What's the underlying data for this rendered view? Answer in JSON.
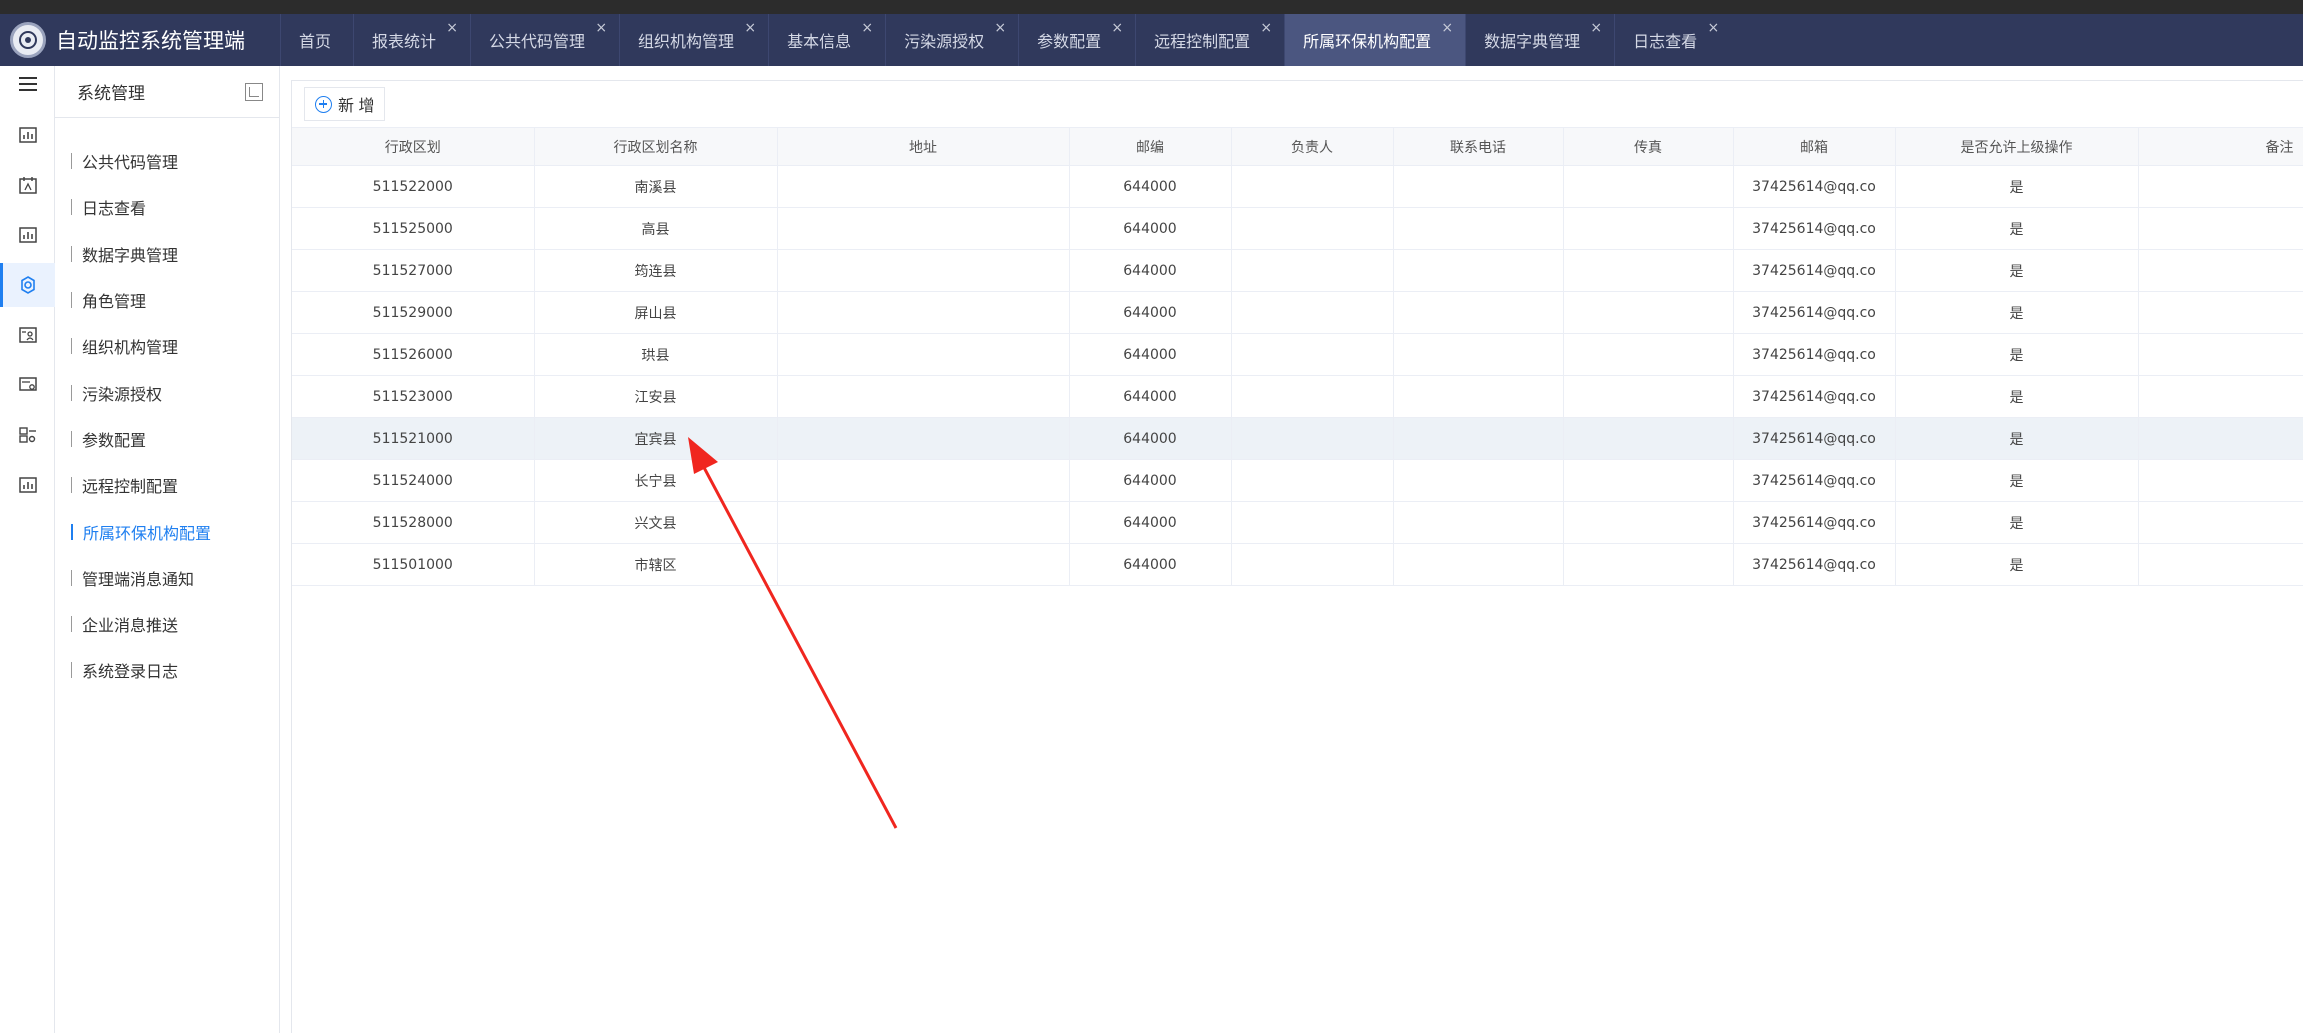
{
  "app": {
    "title": "自动监控系统管理端"
  },
  "tabs": [
    {
      "label": "首页",
      "closable": false,
      "active": false
    },
    {
      "label": "报表统计",
      "closable": true,
      "active": false
    },
    {
      "label": "公共代码管理",
      "closable": true,
      "active": false
    },
    {
      "label": "组织机构管理",
      "closable": true,
      "active": false
    },
    {
      "label": "基本信息",
      "closable": true,
      "active": false
    },
    {
      "label": "污染源授权",
      "closable": true,
      "active": false
    },
    {
      "label": "参数配置",
      "closable": true,
      "active": false
    },
    {
      "label": "远程控制配置",
      "closable": true,
      "active": false
    },
    {
      "label": "所属环保机构配置",
      "closable": true,
      "active": true
    },
    {
      "label": "数据字典管理",
      "closable": true,
      "active": false
    },
    {
      "label": "日志查看",
      "closable": true,
      "active": false
    }
  ],
  "tab_close_glyph": "×",
  "rail": [
    {
      "icon": "report-icon",
      "active": false
    },
    {
      "icon": "calendar-chart-icon",
      "active": false
    },
    {
      "icon": "bar-chart-icon",
      "active": false
    },
    {
      "icon": "settings-gear-icon",
      "active": true
    },
    {
      "icon": "person-card-icon",
      "active": false
    },
    {
      "icon": "monitor-settings-icon",
      "active": false
    },
    {
      "icon": "device-config-icon",
      "active": false
    },
    {
      "icon": "stats-icon",
      "active": false
    }
  ],
  "sidebar": {
    "title": "系统管理",
    "items": [
      {
        "label": "公共代码管理",
        "active": false
      },
      {
        "label": "日志查看",
        "active": false
      },
      {
        "label": "数据字典管理",
        "active": false
      },
      {
        "label": "角色管理",
        "active": false
      },
      {
        "label": "组织机构管理",
        "active": false
      },
      {
        "label": "污染源授权",
        "active": false
      },
      {
        "label": "参数配置",
        "active": false
      },
      {
        "label": "远程控制配置",
        "active": false
      },
      {
        "label": "所属环保机构配置",
        "active": true
      },
      {
        "label": "管理端消息通知",
        "active": false
      },
      {
        "label": "企业消息推送",
        "active": false
      },
      {
        "label": "系统登录日志",
        "active": false
      }
    ]
  },
  "toolbar": {
    "add_label": "新 增"
  },
  "table": {
    "columns": [
      "行政区划",
      "行政区划名称",
      "地址",
      "邮编",
      "负责人",
      "联系电话",
      "传真",
      "邮箱",
      "是否允许上级操作",
      "备注"
    ],
    "rows": [
      [
        "511522000",
        "南溪县",
        "",
        "644000",
        "",
        "",
        "",
        "37425614@qq.co",
        "是",
        ""
      ],
      [
        "511525000",
        "高县",
        "",
        "644000",
        "",
        "",
        "",
        "37425614@qq.co",
        "是",
        ""
      ],
      [
        "511527000",
        "筠连县",
        "",
        "644000",
        "",
        "",
        "",
        "37425614@qq.co",
        "是",
        ""
      ],
      [
        "511529000",
        "屏山县",
        "",
        "644000",
        "",
        "",
        "",
        "37425614@qq.co",
        "是",
        ""
      ],
      [
        "511526000",
        "珙县",
        "",
        "644000",
        "",
        "",
        "",
        "37425614@qq.co",
        "是",
        ""
      ],
      [
        "511523000",
        "江安县",
        "",
        "644000",
        "",
        "",
        "",
        "37425614@qq.co",
        "是",
        ""
      ],
      [
        "511521000",
        "宜宾县",
        "",
        "644000",
        "",
        "",
        "",
        "37425614@qq.co",
        "是",
        ""
      ],
      [
        "511524000",
        "长宁县",
        "",
        "644000",
        "",
        "",
        "",
        "37425614@qq.co",
        "是",
        ""
      ],
      [
        "511528000",
        "兴文县",
        "",
        "644000",
        "",
        "",
        "",
        "37425614@qq.co",
        "是",
        ""
      ],
      [
        "511501000",
        "市辖区",
        "",
        "644000",
        "",
        "",
        "",
        "37425614@qq.co",
        "是",
        ""
      ]
    ],
    "hover_row": 6
  },
  "colors": {
    "header_bg": "#30395c",
    "active_tab_bg": "#4b5680",
    "accent": "#1f7ff0",
    "annotation_arrow": "#f0261f"
  }
}
